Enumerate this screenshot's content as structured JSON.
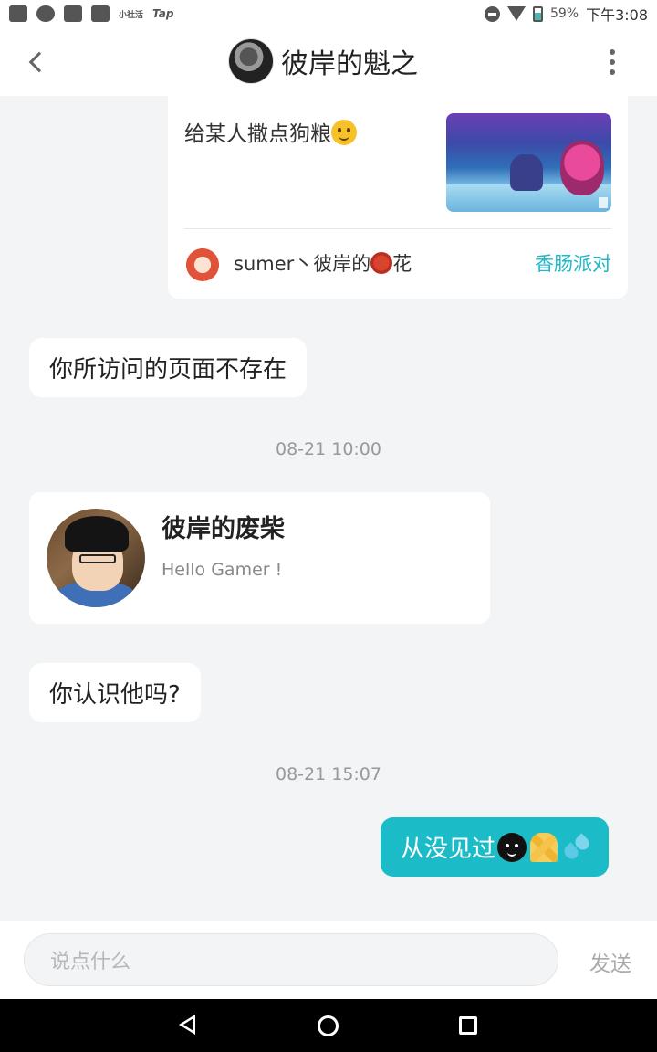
{
  "status_bar": {
    "battery": "59%",
    "time": "下午3:08",
    "notif_small_text": "小社活",
    "notif_tap_text": "Tap"
  },
  "header": {
    "title": "彼岸的魁之"
  },
  "shared_post": {
    "text": "给某人撒点狗粮",
    "author_name_prefix": "sumer丶彼岸的",
    "author_name_suffix": "花",
    "tag": "香肠派对"
  },
  "messages": {
    "msg1": "你所访问的页面不存在",
    "timestamp1": "08-21 10:00",
    "user_card": {
      "name": "彼岸的废柴",
      "signature": "Hello Gamer !"
    },
    "msg2": "你认识他吗?",
    "timestamp2": "08-21 15:07",
    "my_msg": "从没见过"
  },
  "input": {
    "placeholder": "说点什么",
    "send_label": "发送"
  },
  "icons": {
    "back": "chevron-left-icon",
    "more": "more-vertical-icon",
    "nav_back": "triangle-back-icon",
    "nav_home": "circle-home-icon",
    "nav_recent": "square-recent-icon"
  },
  "colors": {
    "accent": "#1bbcc8",
    "tag": "#1fb8c8",
    "background": "#f2f4f5"
  }
}
